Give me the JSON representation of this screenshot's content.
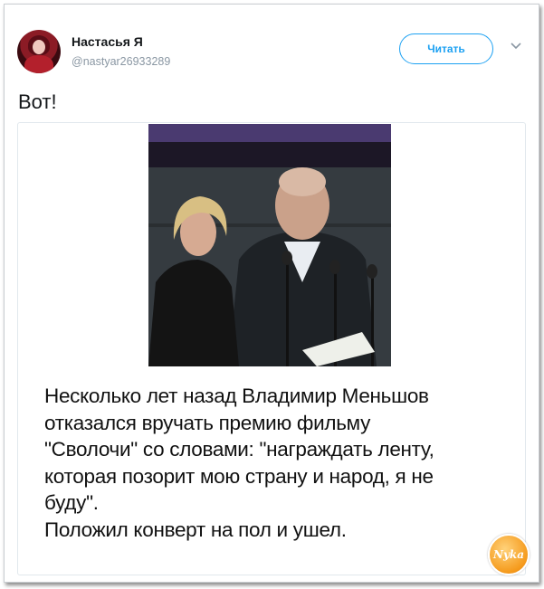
{
  "tweet": {
    "author_name": "Настасья Я",
    "author_handle": "@nastyar26933289",
    "follow_label": "Читать",
    "text": "Вот!"
  },
  "image_caption": {
    "lines": [
      "Несколько лет назад Владимир Меньшов",
      "отказался вручать премию фильму",
      "\"Сволочи\" со словами: \"награждать ленту,",
      "которая позорит мою страну и народ, я не",
      "буду\".",
      "Положил конверт на пол и ушел."
    ]
  },
  "watermark": {
    "text": "Nyka"
  },
  "colors": {
    "accent": "#1da1f2",
    "handle": "#8a97a3",
    "watermark": "#f59a1c"
  }
}
